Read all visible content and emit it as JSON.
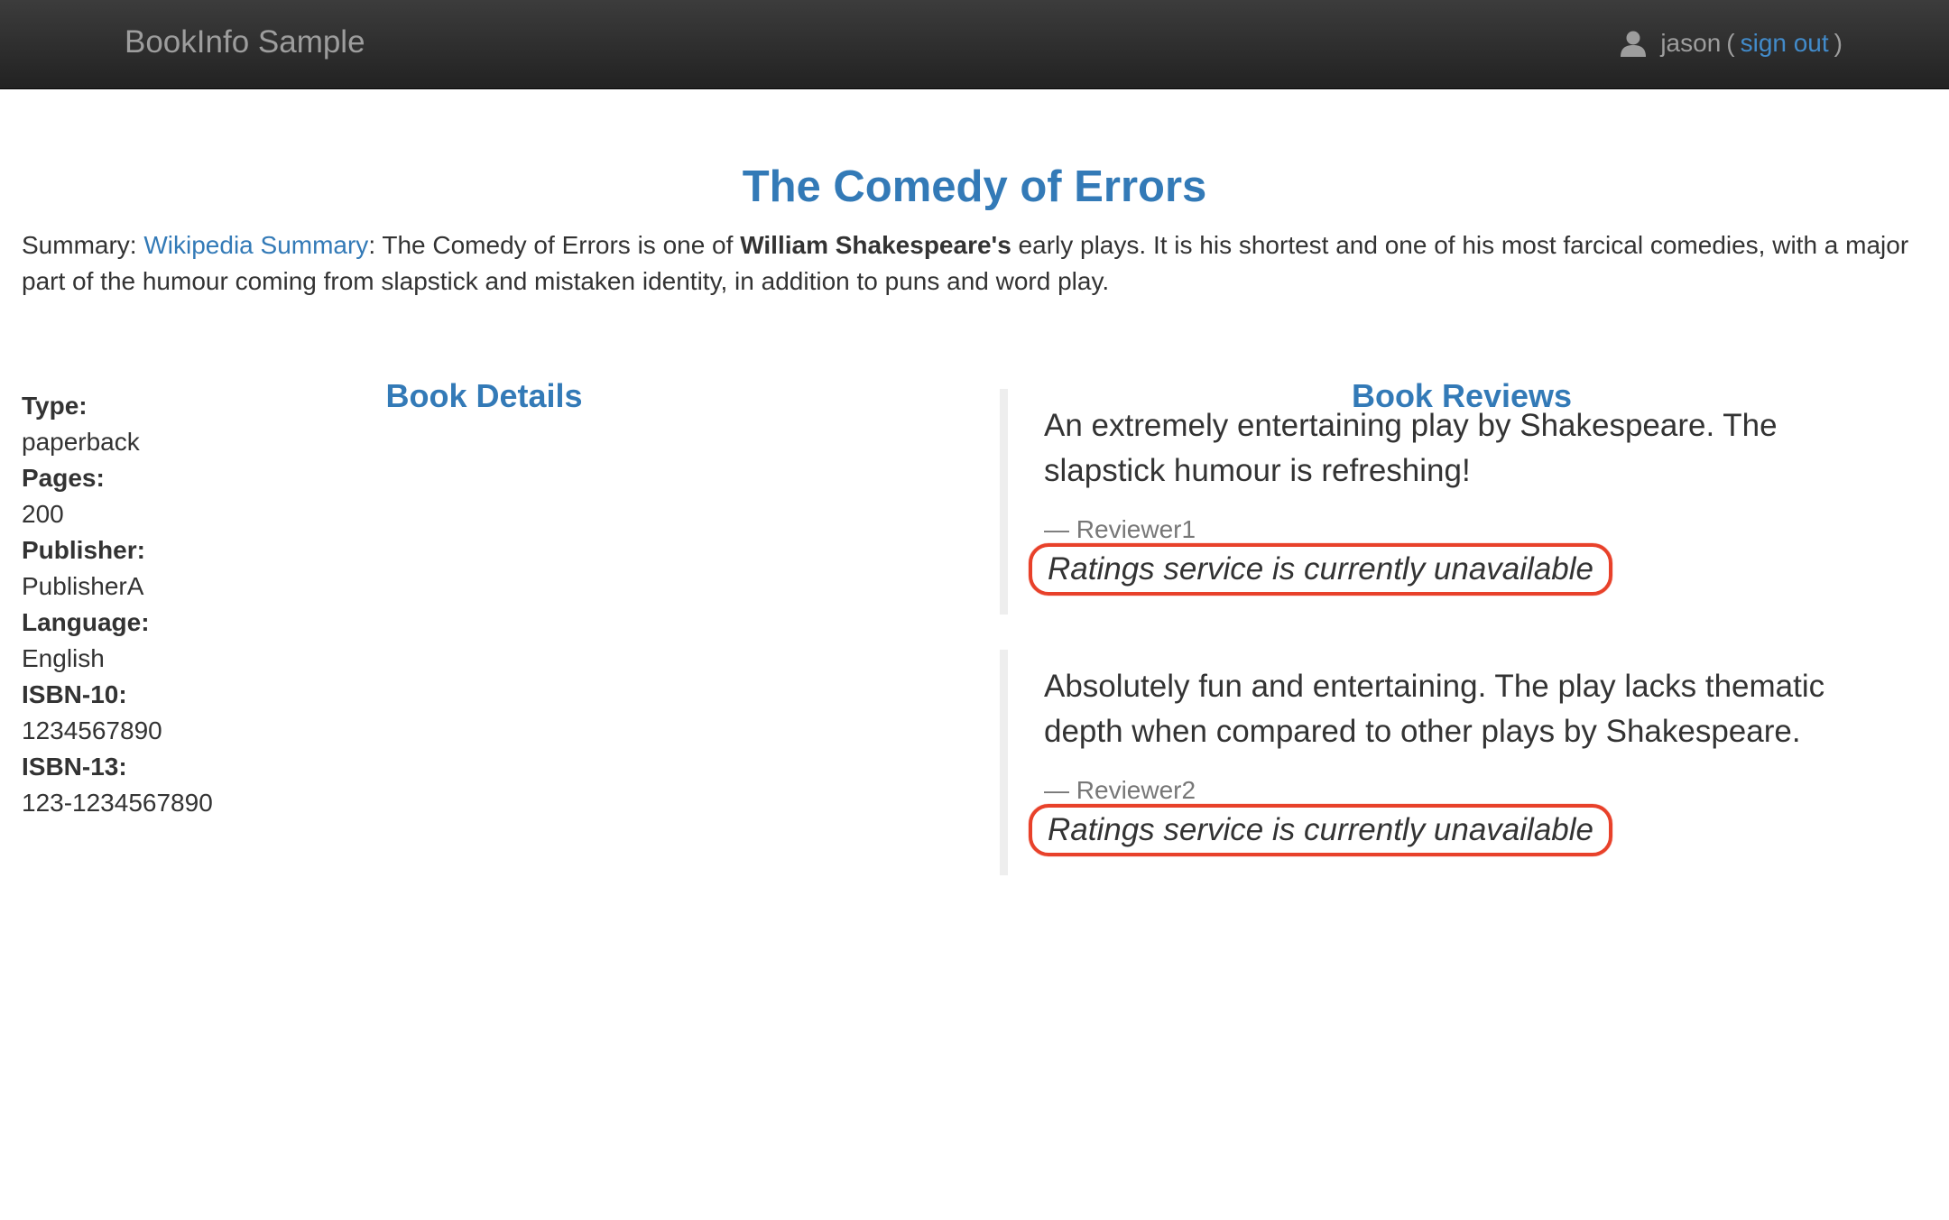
{
  "navbar": {
    "brand": "BookInfo Sample",
    "username": "jason",
    "open_paren": "(",
    "close_paren": ")",
    "sign_out": "sign out"
  },
  "book": {
    "title": "The Comedy of Errors",
    "summary_label": "Summary:",
    "summary_link": "Wikipedia Summary",
    "summary_text_1": ": The Comedy of Errors is one of ",
    "summary_bold": "William Shakespeare's",
    "summary_text_2": " early plays. It is his shortest and one of his most farcical comedies, with a major part of the humour coming from slapstick and mistaken identity, in addition to puns and word play."
  },
  "details": {
    "heading": "Book Details",
    "items": [
      {
        "label": "Type:",
        "value": "paperback"
      },
      {
        "label": "Pages:",
        "value": "200"
      },
      {
        "label": "Publisher:",
        "value": "PublisherA"
      },
      {
        "label": "Language:",
        "value": "English"
      },
      {
        "label": "ISBN-10:",
        "value": "1234567890"
      },
      {
        "label": "ISBN-13:",
        "value": "123-1234567890"
      }
    ]
  },
  "reviews": {
    "heading": "Book Reviews",
    "items": [
      {
        "text": "An extremely entertaining play by Shakespeare. The slapstick humour is refreshing!",
        "reviewer": "— Reviewer1",
        "rating": "Ratings service is currently unavailable"
      },
      {
        "text": "Absolutely fun and entertaining. The play lacks thematic depth when compared to other plays by Shakespeare.",
        "reviewer": "— Reviewer2",
        "rating": "Ratings service is currently unavailable"
      }
    ]
  },
  "colors": {
    "navbar": "#222222",
    "link": "#337ab7",
    "highlight": "#e8412a"
  },
  "icons": {
    "user": "user-icon"
  }
}
